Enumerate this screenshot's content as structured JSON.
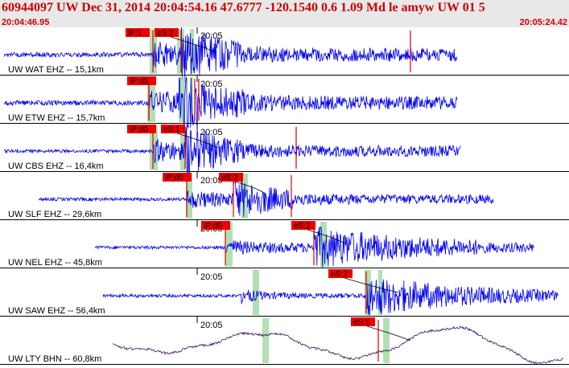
{
  "header": {
    "title": "60944097 UW Dec 31, 2014 20:04:54.16    47.6777 -120.1540  0.6 1.09 Md le amyw UW 01    5",
    "time_start": "20:04:46.95",
    "time_end": "20:05:24.42"
  },
  "time_label": "20:05",
  "colors": {
    "trace": "#0000ee",
    "trace_long_period": "#3a1060",
    "pick": "#dd0000",
    "pick_label_bg": "#ee0000",
    "window_band": "#99d699",
    "header_bg": "#e8e8e8",
    "header_text": "#cc0000"
  },
  "channels": [
    {
      "label": "UW WAT EHZ -- 15,1km",
      "picks": [
        {
          "label": "iP:1",
          "kind": "P"
        },
        {
          "label": "eS:2",
          "kind": "S"
        }
      ]
    },
    {
      "label": "UW ETW EHZ -- 15,7km",
      "picks": [
        {
          "label": "iP:d0",
          "kind": "P"
        },
        {
          "label": "",
          "kind": "S"
        }
      ]
    },
    {
      "label": "UW CBS EHZ -- 16,4km",
      "picks": [
        {
          "label": "iP:d0",
          "kind": "P"
        },
        {
          "label": "eS:1",
          "kind": "S"
        }
      ]
    },
    {
      "label": "UW SLF EHZ -- 29,6km",
      "picks": [
        {
          "label": "iP:d0",
          "kind": "P"
        },
        {
          "label": "eS:2",
          "kind": "S"
        }
      ]
    },
    {
      "label": "UW NEL EHZ -- 45,8km",
      "picks": [
        {
          "label": "iP:d0",
          "kind": "P"
        },
        {
          "label": "eS:2",
          "kind": "S"
        }
      ]
    },
    {
      "label": "UW SAW EHZ -- 56,4km",
      "picks": [
        {
          "label": "eS:2",
          "kind": "S"
        }
      ]
    },
    {
      "label": "UW LTY BHN -- 60,8km",
      "picks": [
        {
          "label": "eS:1",
          "kind": "S"
        }
      ]
    }
  ]
}
